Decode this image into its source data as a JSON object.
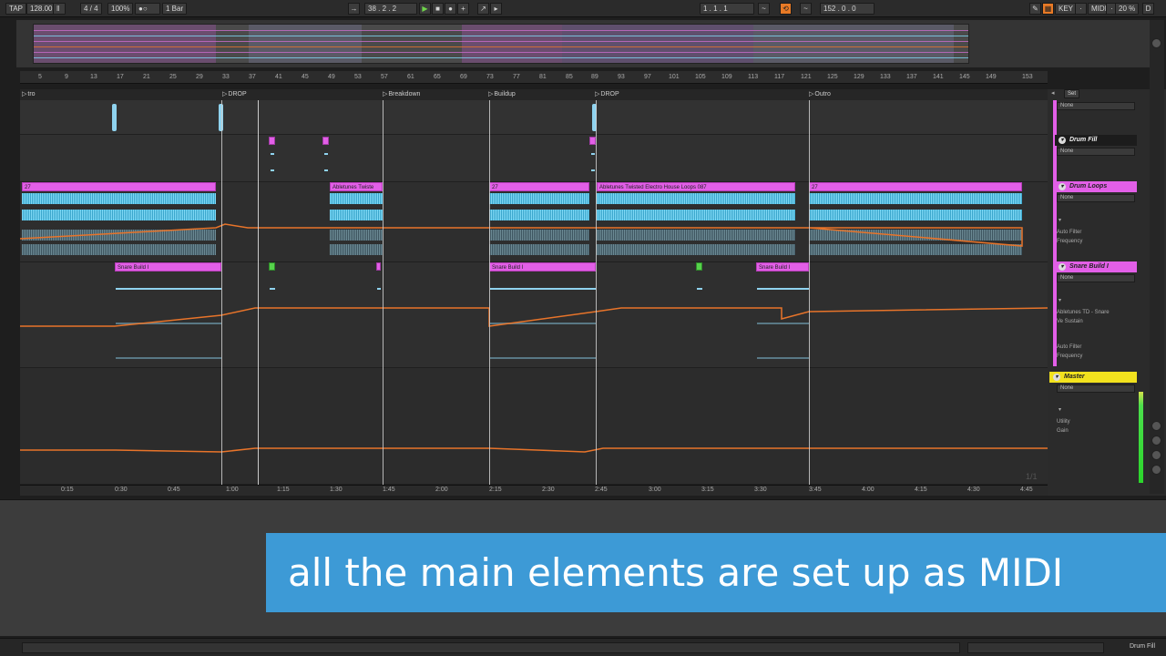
{
  "transport": {
    "tap": "TAP",
    "tempo": "128.00",
    "time_signature": "4 / 4",
    "zoom": "100%",
    "quantize": "1 Bar",
    "position": "38 . 2 . 2",
    "loop_start": "1 . 1 . 1",
    "loop_length": "152 . 0 . 0",
    "key_label": "KEY",
    "midi_label": "MIDI",
    "cpu": "20 %"
  },
  "bar_numbers": [
    "5",
    "9",
    "13",
    "17",
    "21",
    "25",
    "29",
    "33",
    "37",
    "41",
    "45",
    "49",
    "53",
    "57",
    "61",
    "65",
    "69",
    "73",
    "77",
    "81",
    "85",
    "89",
    "93",
    "97",
    "101",
    "105",
    "109",
    "113",
    "117",
    "121",
    "125",
    "129",
    "133",
    "137",
    "141",
    "145",
    "149",
    "153"
  ],
  "locators": [
    {
      "label": "tro"
    },
    {
      "label": "DROP"
    },
    {
      "label": "Breakdown"
    },
    {
      "label": "Buildup"
    },
    {
      "label": "DROP"
    },
    {
      "label": "Outro"
    }
  ],
  "clips": {
    "drum_loop_1": "27",
    "drum_loop_2": "Abletunes Twiste",
    "drum_loop_3": "27",
    "drum_loop_4": "Abletunes Twisted Electro House Loops 087",
    "drum_loop_5": "27",
    "snare_1": "Snare Build I",
    "snare_2": "Snare Build I",
    "snare_3": "Snare Build I"
  },
  "time_ticks": [
    "0:15",
    "0:30",
    "0:45",
    "1:00",
    "1:15",
    "1:30",
    "1:45",
    "2:00",
    "2:15",
    "2:30",
    "2:45",
    "3:00",
    "3:15",
    "3:30",
    "3:45",
    "4:00",
    "4:15",
    "4:30",
    "4:45"
  ],
  "zoom_indicator": "1/1",
  "side_panel": {
    "set_label": "Set",
    "none_top": "None",
    "drum_fill": {
      "name": "Drum Fill",
      "input": "None"
    },
    "drum_loops": {
      "name": "Drum Loops",
      "input": "None",
      "device": "Auto Filter",
      "param": "Frequency"
    },
    "snare_build": {
      "name": "Snare Build I",
      "input": "None",
      "device": "Abletunes TD - Snare",
      "param": "Ve Sustain",
      "device2": "Auto Filter",
      "param2": "Frequency"
    },
    "master": {
      "name": "Master",
      "input": "None",
      "device": "Utility",
      "param": "Gain"
    }
  },
  "caption": "all the main elements are set up as MIDI",
  "status_bar": {
    "selected_track": "Drum Fill"
  },
  "colors": {
    "clip_pink": "#e25fe7",
    "waveform_blue": "#7fd8f5",
    "automation_orange": "#e8742a",
    "caption_blue": "#3d9ad6",
    "master_yellow": "#f2e21e",
    "clip_green": "#56d24b"
  }
}
